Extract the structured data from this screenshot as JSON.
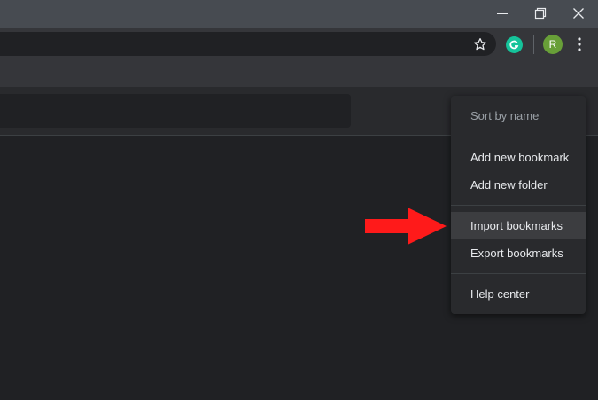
{
  "window": {
    "minimize_icon": "minimize-icon",
    "restore_icon": "restore-icon",
    "close_icon": "close-icon"
  },
  "toolbar": {
    "star_icon": "star-outline-icon",
    "extension_icon": "grammarly-icon",
    "avatar_letter": "R",
    "menu_icon": "vertical-dots-icon"
  },
  "menu": {
    "items": [
      {
        "label": "Sort by name",
        "disabled": true
      },
      {
        "label": "Add new bookmark"
      },
      {
        "label": "Add new folder"
      },
      {
        "label": "Import bookmarks",
        "hovered": true
      },
      {
        "label": "Export bookmarks"
      },
      {
        "label": "Help center"
      }
    ]
  },
  "annotation": {
    "arrow_color": "#ff1a1a"
  },
  "colors": {
    "titlebar": "#474b51",
    "toolbar": "#35363a",
    "page_background": "#202124",
    "menu_background": "#292a2d",
    "menu_text": "#e8eaed",
    "menu_text_disabled": "#9aa0a6",
    "avatar": "#689f38",
    "grammarly": "#15c39a"
  }
}
